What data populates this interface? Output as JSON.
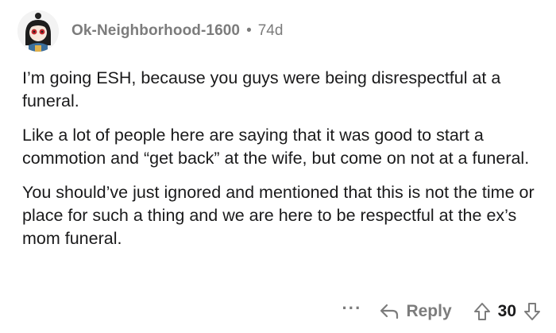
{
  "comment": {
    "author": "Ok-Neighborhood-1600",
    "separator": "•",
    "age": "74d",
    "avatar_icon": "avatar-icon",
    "paragraphs": [
      "I’m going ESH, because you guys were being disrespectful at a funeral.",
      "Like a lot of people here are saying that it was good to start a commotion and “get back” at the wife, but come on not at a funeral.",
      "You should’ve just ignored and mentioned that this is not the time or place for such a thing and we are here to be respectful at the ex’s mom funeral."
    ],
    "actions": {
      "more_label": "···",
      "reply_label": "Reply",
      "score": "30",
      "reply_icon": "reply-arrow-icon",
      "upvote_icon": "upvote-arrow-icon",
      "downvote_icon": "downvote-arrow-icon"
    }
  },
  "colors": {
    "meta_gray": "#7c7c7c",
    "text": "#1a1a1b",
    "background": "#ffffff"
  }
}
